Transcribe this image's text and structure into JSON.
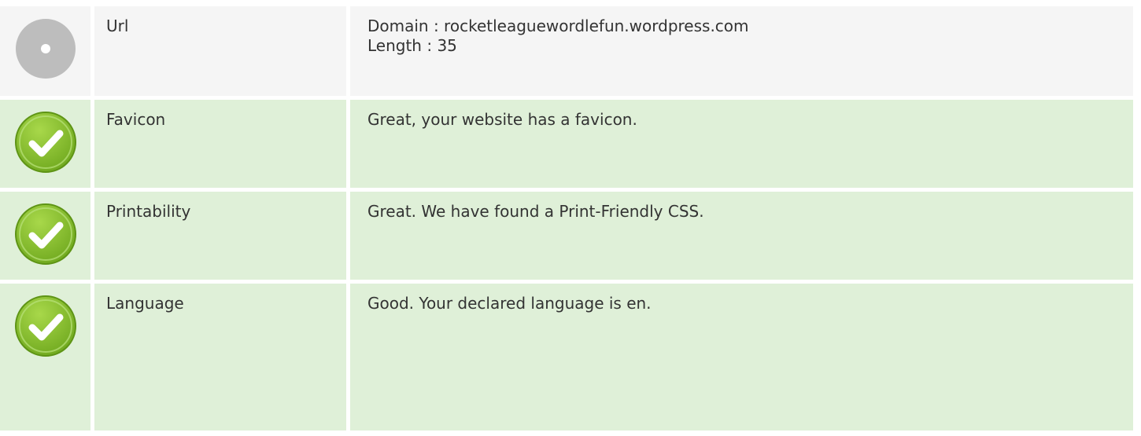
{
  "rows": [
    {
      "label": "Url",
      "status": "neutral",
      "icon": "neutral-circle-icon",
      "lines": [
        "Domain : rocketleaguewordlefun.wordpress.com",
        "Length : 35"
      ]
    },
    {
      "label": "Favicon",
      "status": "good",
      "icon": "checkmark-icon",
      "lines": [
        "Great, your website has a favicon."
      ]
    },
    {
      "label": "Printability",
      "status": "good",
      "icon": "checkmark-icon",
      "lines": [
        "Great. We have found a Print-Friendly CSS."
      ]
    },
    {
      "label": "Language",
      "status": "good",
      "icon": "checkmark-icon",
      "lines": [
        "Good. Your declared language is en."
      ]
    }
  ],
  "colors": {
    "good_background": "#dff0d8",
    "neutral_background": "#f5f5f5",
    "check_green": "#8cc63f",
    "neutral_gray": "#bdbdbd"
  }
}
